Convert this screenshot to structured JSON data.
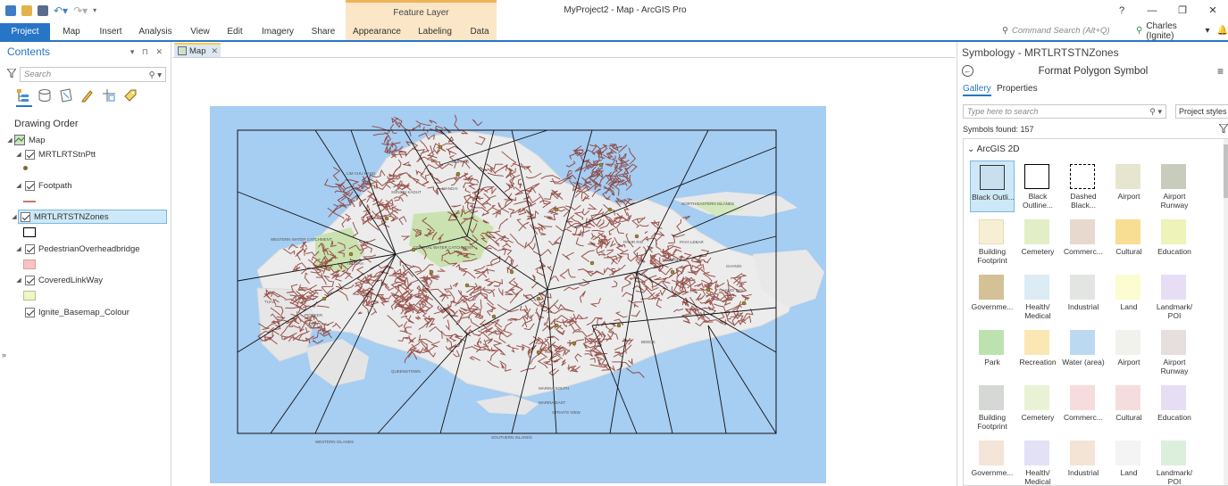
{
  "window": {
    "title": "MyProject2 - Map - ArcGIS Pro",
    "context_label": "Feature Layer",
    "help": "?",
    "minimize": "—",
    "maximize": "❐",
    "close": "✕"
  },
  "ribbon": {
    "tabs": [
      "Project",
      "Map",
      "Insert",
      "Analysis",
      "View",
      "Edit",
      "Imagery",
      "Share",
      "Appearance",
      "Labeling",
      "Data"
    ],
    "command_search_placeholder": "Command Search (Alt+Q)",
    "user": "Charles (Ignite)",
    "user_caret": "▾"
  },
  "contents": {
    "title": "Contents",
    "controls": "▾ ⊓ ✕",
    "search_placeholder": "Search",
    "drawing_order": "Drawing Order",
    "map_label": "Map",
    "layers": [
      {
        "name": "MRTLRTStnPtt",
        "symbol": "point",
        "color": "#7b6a3a"
      },
      {
        "name": "Footpath",
        "symbol": "line",
        "color": "#c8776e"
      },
      {
        "name": "MRTLRTSTNZones",
        "symbol": "polygon-outline",
        "color": "#000000"
      },
      {
        "name": "PedestrianOverheadbridge",
        "symbol": "polygon-fill",
        "color": "#f5c4c4"
      },
      {
        "name": "CoveredLinkWay",
        "symbol": "polygon-fill",
        "color": "#eef5c8"
      },
      {
        "name": "Ignite_Basemap_Colour",
        "symbol": "none",
        "color": ""
      }
    ],
    "collapse_glyph": "»"
  },
  "map_tab": {
    "label": "Map",
    "close": "✕"
  },
  "map_labels": [
    "LIM CHU KANG",
    "SUNGEI KADUT",
    "MANDAI",
    "SIMPANG",
    "NORTH-EASTERN ISLANDS",
    "WESTERN WATER CATCHMENT",
    "CENTRAL WATER CATCHMENT",
    "PASIR RIS",
    "TENGAH",
    "CHANGI",
    "CHANGI BAY",
    "TUAS",
    "PIONEER",
    "BOON LAY",
    "QUEENSTOWN",
    "BEDOK",
    "MARINA SOUTH",
    "MARINA EAST",
    "STRAITS VIEW",
    "SOUTHERN ISLANDS",
    "WESTERN ISLANDS",
    "PAYA LEBAR",
    "TAMPINES"
  ],
  "symbology": {
    "title": "Symbology - MRTLRTSTNZones",
    "subtitle": "Format Polygon Symbol",
    "back_icon": "←",
    "menu_icon": "≡",
    "tabs": [
      "Gallery",
      "Properties"
    ],
    "search_placeholder": "Type here to search",
    "styles_dropdown": "Project styles",
    "found": "Symbols found: 157",
    "group": "ArcGIS 2D",
    "group_caret": "⌄",
    "symbols": [
      {
        "label": "Black Outli...",
        "fill": "#c7dfee",
        "border": "#333333",
        "dashed": false,
        "selected": true
      },
      {
        "label": "Black Outline...",
        "fill": "#ffffff",
        "border": "#000000",
        "dashed": false,
        "selected": false
      },
      {
        "label": "Dashed Black...",
        "fill": "#ffffff",
        "border": "#000000",
        "dashed": true,
        "selected": false
      },
      {
        "label": "Airport",
        "fill": "#e6e6cf",
        "border": "#e6e6cf",
        "dashed": false,
        "selected": false
      },
      {
        "label": "Airport Runway",
        "fill": "#c8ccbc",
        "border": "#c8ccbc",
        "dashed": false,
        "selected": false
      },
      {
        "label": "Building Footprint",
        "fill": "#f6efd4",
        "border": "#e8dcba",
        "dashed": false,
        "selected": false
      },
      {
        "label": "Cemetery",
        "fill": "#e2efc6",
        "border": "#e2efc6",
        "dashed": false,
        "selected": false
      },
      {
        "label": "Commerc...",
        "fill": "#e8d9cf",
        "border": "#e8d9cf",
        "dashed": false,
        "selected": false
      },
      {
        "label": "Cultural",
        "fill": "#f8de93",
        "border": "#f8de93",
        "dashed": false,
        "selected": false
      },
      {
        "label": "Education",
        "fill": "#eef3b9",
        "border": "#eef3b9",
        "dashed": false,
        "selected": false
      },
      {
        "label": "Governme...",
        "fill": "#d4c196",
        "border": "#d4c196",
        "dashed": false,
        "selected": false
      },
      {
        "label": "Health/ Medical",
        "fill": "#dcebf4",
        "border": "#dcebf4",
        "dashed": false,
        "selected": false
      },
      {
        "label": "Industrial",
        "fill": "#e3e5e2",
        "border": "#e3e5e2",
        "dashed": false,
        "selected": false
      },
      {
        "label": "Land",
        "fill": "#fbfccf",
        "border": "#fbfccf",
        "dashed": false,
        "selected": false
      },
      {
        "label": "Landmark/ POI",
        "fill": "#e7def6",
        "border": "#e7def6",
        "dashed": false,
        "selected": false
      },
      {
        "label": "Park",
        "fill": "#bde2b0",
        "border": "#bde2b0",
        "dashed": false,
        "selected": false
      },
      {
        "label": "Recreation",
        "fill": "#fbe7b3",
        "border": "#fbe7b3",
        "dashed": false,
        "selected": false
      },
      {
        "label": "Water (area)",
        "fill": "#bcd9f2",
        "border": "#bcd9f2",
        "dashed": false,
        "selected": false
      },
      {
        "label": "Airport",
        "fill": "#f2f2ec",
        "border": "#f2f2ec",
        "dashed": false,
        "selected": false
      },
      {
        "label": "Airport Runway",
        "fill": "#e6dfdd",
        "border": "#e6dfdd",
        "dashed": false,
        "selected": false
      },
      {
        "label": "Building Footprint",
        "fill": "#d6d8d6",
        "border": "#d6d8d6",
        "dashed": false,
        "selected": false
      },
      {
        "label": "Cemetery",
        "fill": "#eaf2d5",
        "border": "#eaf2d5",
        "dashed": false,
        "selected": false
      },
      {
        "label": "Commerc...",
        "fill": "#f6dcdc",
        "border": "#f6dcdc",
        "dashed": false,
        "selected": false
      },
      {
        "label": "Cultural",
        "fill": "#f6dddd",
        "border": "#f6dddd",
        "dashed": false,
        "selected": false
      },
      {
        "label": "Education",
        "fill": "#e6def3",
        "border": "#e6def3",
        "dashed": false,
        "selected": false
      },
      {
        "label": "Governme...",
        "fill": "#f3e5d8",
        "border": "#f3e5d8",
        "dashed": false,
        "selected": false
      },
      {
        "label": "Health/ Medical",
        "fill": "#e2e1f6",
        "border": "#e2e1f6",
        "dashed": false,
        "selected": false
      },
      {
        "label": "Industrial",
        "fill": "#f4e4d6",
        "border": "#f4e4d6",
        "dashed": false,
        "selected": false
      },
      {
        "label": "Land",
        "fill": "#f4f4f4",
        "border": "#f4f4f4",
        "dashed": false,
        "selected": false
      },
      {
        "label": "Landmark/ POI",
        "fill": "#dcefdc",
        "border": "#dcefdc",
        "dashed": false,
        "selected": false
      }
    ]
  },
  "colors": {
    "accent": "#2775c6",
    "context_band": "#fbe7c8",
    "water": "#a6cdf2",
    "land": "#eeeeee",
    "park": "#c9e2b0",
    "roads": "#8a3a32",
    "stations": "#9c8a2e"
  }
}
